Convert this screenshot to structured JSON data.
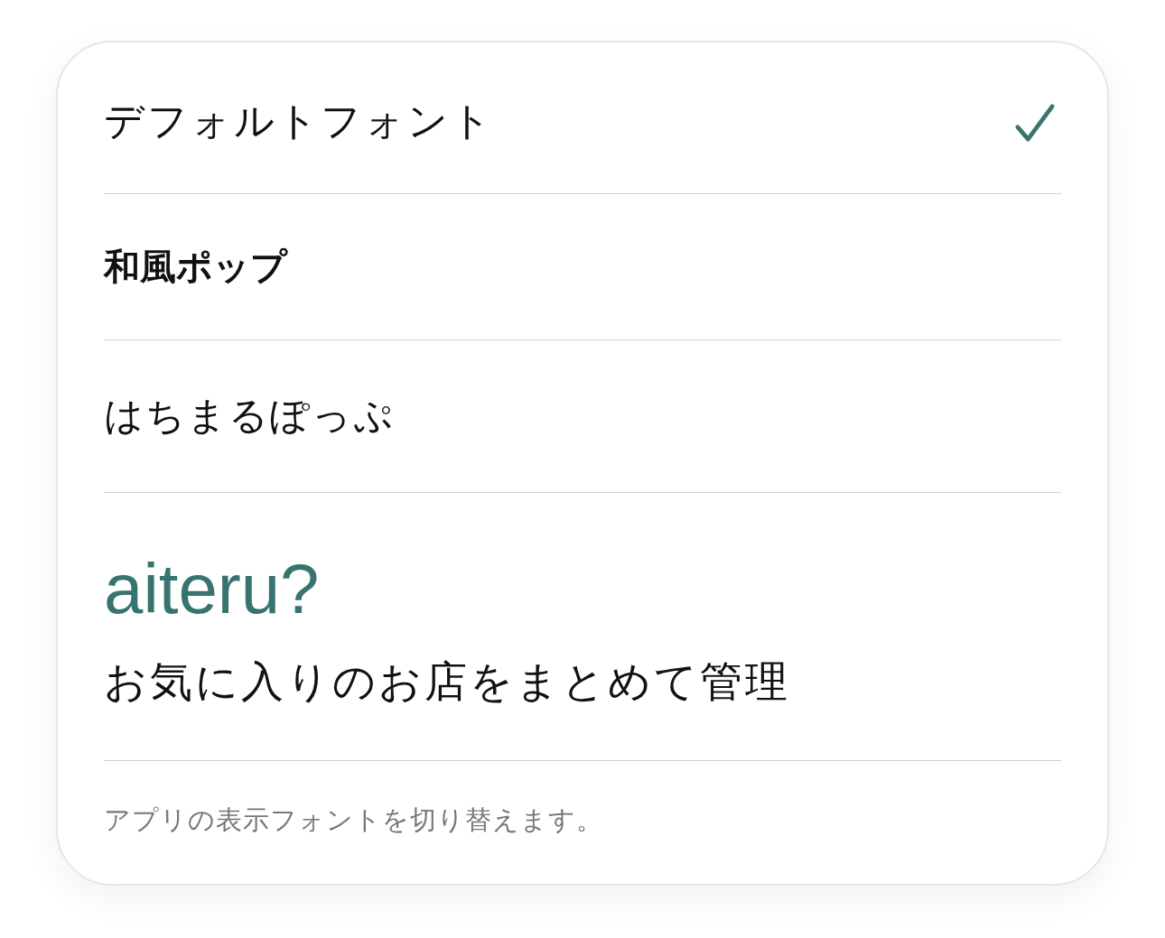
{
  "font_options": [
    {
      "label": "デフォルトフォント",
      "selected": true,
      "kind": "default"
    },
    {
      "label": "和風ポップ",
      "selected": false,
      "kind": "pop"
    },
    {
      "label": "はちまるぽっぷ",
      "selected": false,
      "kind": "round"
    }
  ],
  "preview": {
    "app_name": "aiteru?",
    "tagline": "お気に入りのお店をまとめて管理"
  },
  "footer": "アプリの表示フォントを切り替えます。"
}
